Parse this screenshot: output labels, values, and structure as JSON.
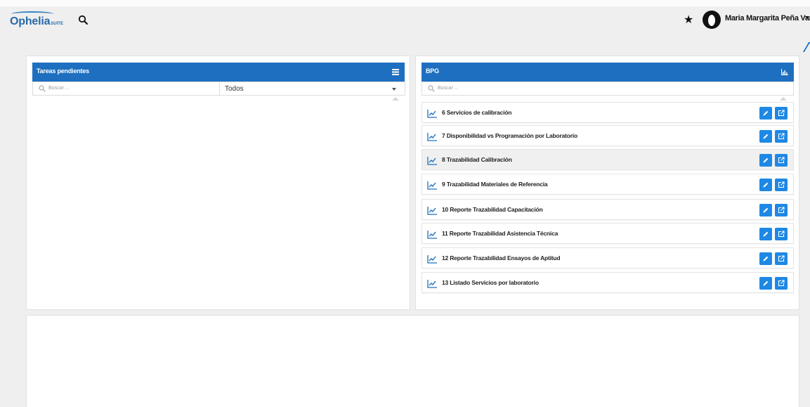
{
  "header": {
    "logo_text": "Ophelia",
    "logo_sub": "SUITE",
    "user_name": "Maria Margarita Peña Vargas",
    "icons": [
      "search-icon",
      "star-icon",
      "avatar",
      "chevron-down-icon"
    ]
  },
  "left_panel": {
    "title": "Tareas pendientes",
    "search_placeholder": "Buscar ...",
    "filter_value": "Todos"
  },
  "right_panel": {
    "title": "BPG",
    "search_placeholder": "Buscar ...",
    "items": [
      {
        "label": "6 Servicios de calibración"
      },
      {
        "label": "7 Disponibilidad vs Programación por Laboratorio"
      },
      {
        "label": "8 Trazabilidad Calibración"
      },
      {
        "label": "9 Trazabilidad Materiales de Referencia"
      },
      {
        "label": "10 Reporte Trazabilidad Capacitación"
      },
      {
        "label": "11 Reporte Trazabilidad Asistencia Técnica"
      },
      {
        "label": "12 Reporte Trazabilidad Ensayos de Aptitud"
      },
      {
        "label": "13 Listado Servicios por laboratorio"
      }
    ]
  },
  "colors": {
    "header_blue": "#1e6fbf",
    "button_blue": "#1e88e5",
    "background": "#efefef"
  }
}
